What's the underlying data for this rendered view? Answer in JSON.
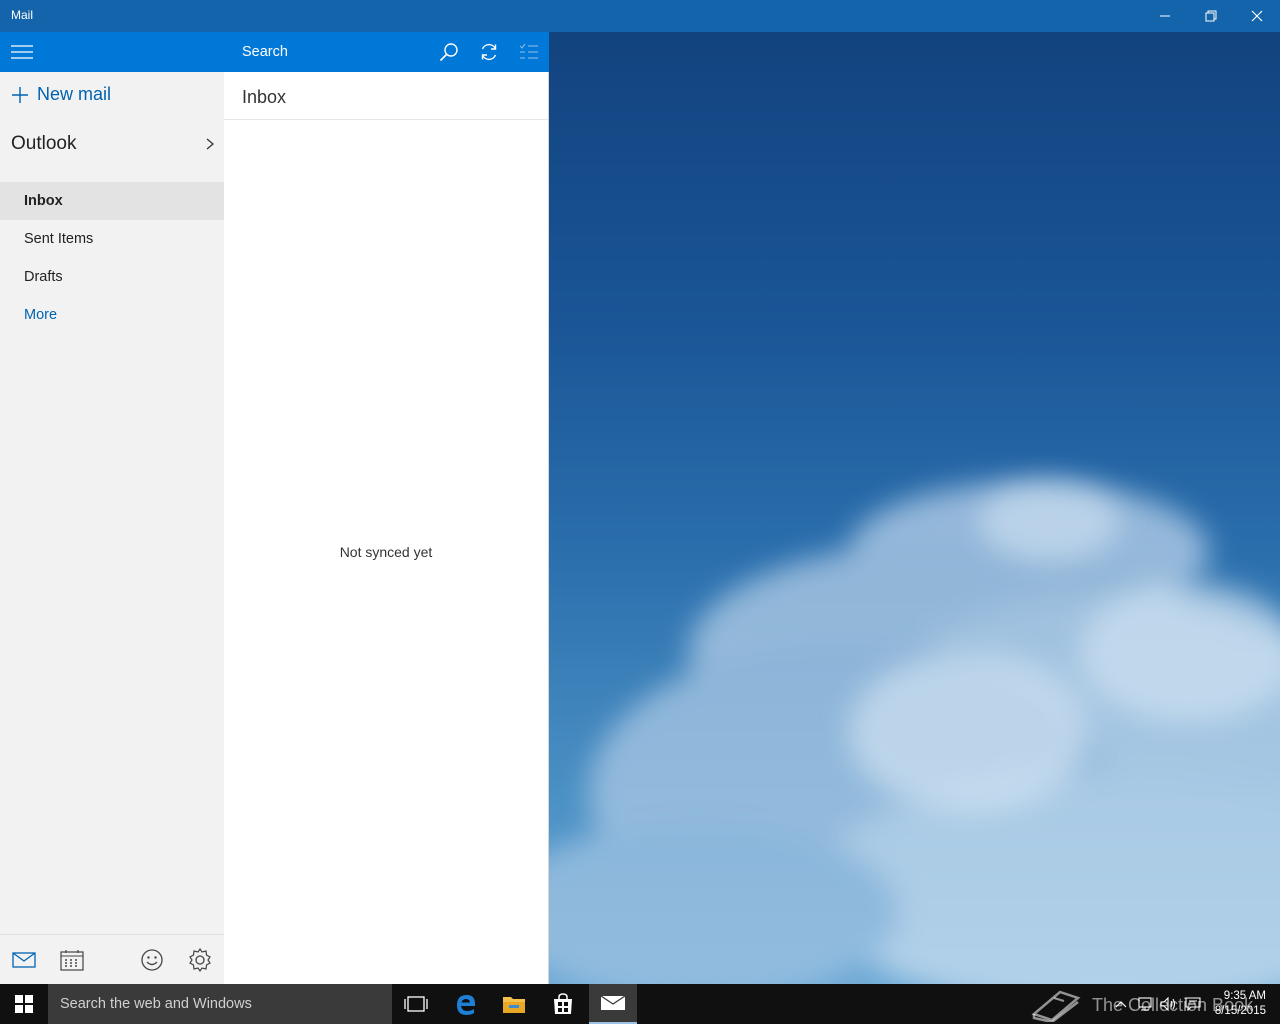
{
  "window": {
    "title": "Mail"
  },
  "nav": {
    "new_mail": "New mail",
    "account": "Outlook",
    "folders": [
      {
        "label": "Inbox",
        "active": true
      },
      {
        "label": "Sent Items"
      },
      {
        "label": "Drafts"
      },
      {
        "label": "More"
      }
    ],
    "bottom_icons": [
      "mail-icon",
      "calendar-icon",
      "feedback-smiley-icon",
      "settings-gear-icon"
    ]
  },
  "list": {
    "search_placeholder": "Search",
    "header": "Inbox",
    "empty_message": "Not synced yet"
  },
  "taskbar": {
    "search_placeholder": "Search the web and Windows",
    "apps": [
      "task-view-icon",
      "edge-icon",
      "file-explorer-icon",
      "store-icon",
      "mail-icon"
    ],
    "time": "9:35 AM",
    "date": "8/15/2015"
  },
  "watermark": {
    "text": "The Collection Book"
  },
  "colors": {
    "titlebar": "#1464ab",
    "accent": "#0078d7",
    "link": "#0063b1",
    "taskbar": "#101010"
  }
}
